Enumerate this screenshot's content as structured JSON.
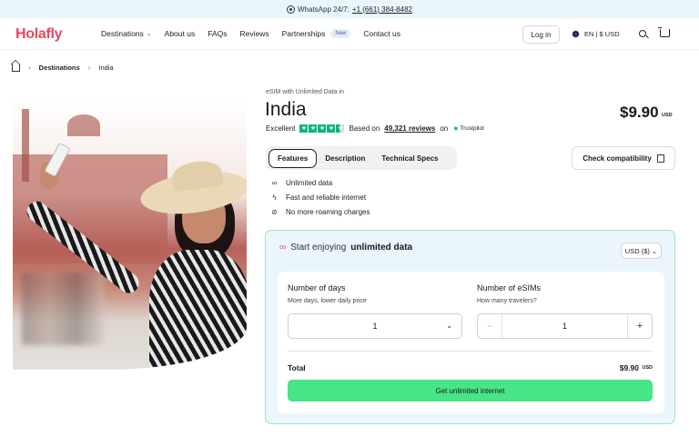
{
  "topbar": {
    "whatsapp_label": "WhatsApp 24/7:",
    "phone": "+1 (661) 384-8482"
  },
  "header": {
    "logo": "Holafly",
    "nav": [
      {
        "label": "Destinations",
        "has_dropdown": true
      },
      {
        "label": "About us"
      },
      {
        "label": "FAQs"
      },
      {
        "label": "Reviews"
      },
      {
        "label": "Partnerships",
        "badge": "New"
      },
      {
        "label": "Contact us"
      }
    ],
    "login": "Log in",
    "locale": "EN | $ USD"
  },
  "breadcrumb": {
    "section": "Destinations",
    "current": "India"
  },
  "product": {
    "eyebrow": "eSIM with Unlimited Data in",
    "title": "India",
    "price": "$9.90",
    "price_currency": "USD",
    "rating_label": "Excellent",
    "rating_stars": 4.5,
    "based_on": "Based on",
    "reviews_count": "49,321 reviews",
    "on": "on",
    "trustpilot": "Trustpilot"
  },
  "tabs": [
    "Features",
    "Description",
    "Technical Specs"
  ],
  "check_compat": "Check compatibility",
  "features": [
    {
      "icon": "infinity-icon",
      "label": "Unlimited data"
    },
    {
      "icon": "bolt-icon",
      "label": "Fast and reliable internet"
    },
    {
      "icon": "no-roaming-icon",
      "label": "No more roaming charges"
    }
  ],
  "purchase": {
    "heading_prefix": "Start enjoying",
    "heading_strong": "unlimited data",
    "currency_select": "USD ($)",
    "days_label": "Number of days",
    "days_sub": "More days, lower daily price",
    "days_value": "1",
    "esims_label": "Number of eSIMs",
    "esims_sub": "How many travelers?",
    "esims_value": "1",
    "total_label": "Total",
    "total_value": "$9.90",
    "total_currency": "USD",
    "cta": "Get unlimited internet"
  },
  "colors": {
    "brand": "#e6485a",
    "cta": "#47e585",
    "trustpilot": "#00b67a",
    "card_bg": "#eaf6fb",
    "card_border": "#9fe3be"
  }
}
